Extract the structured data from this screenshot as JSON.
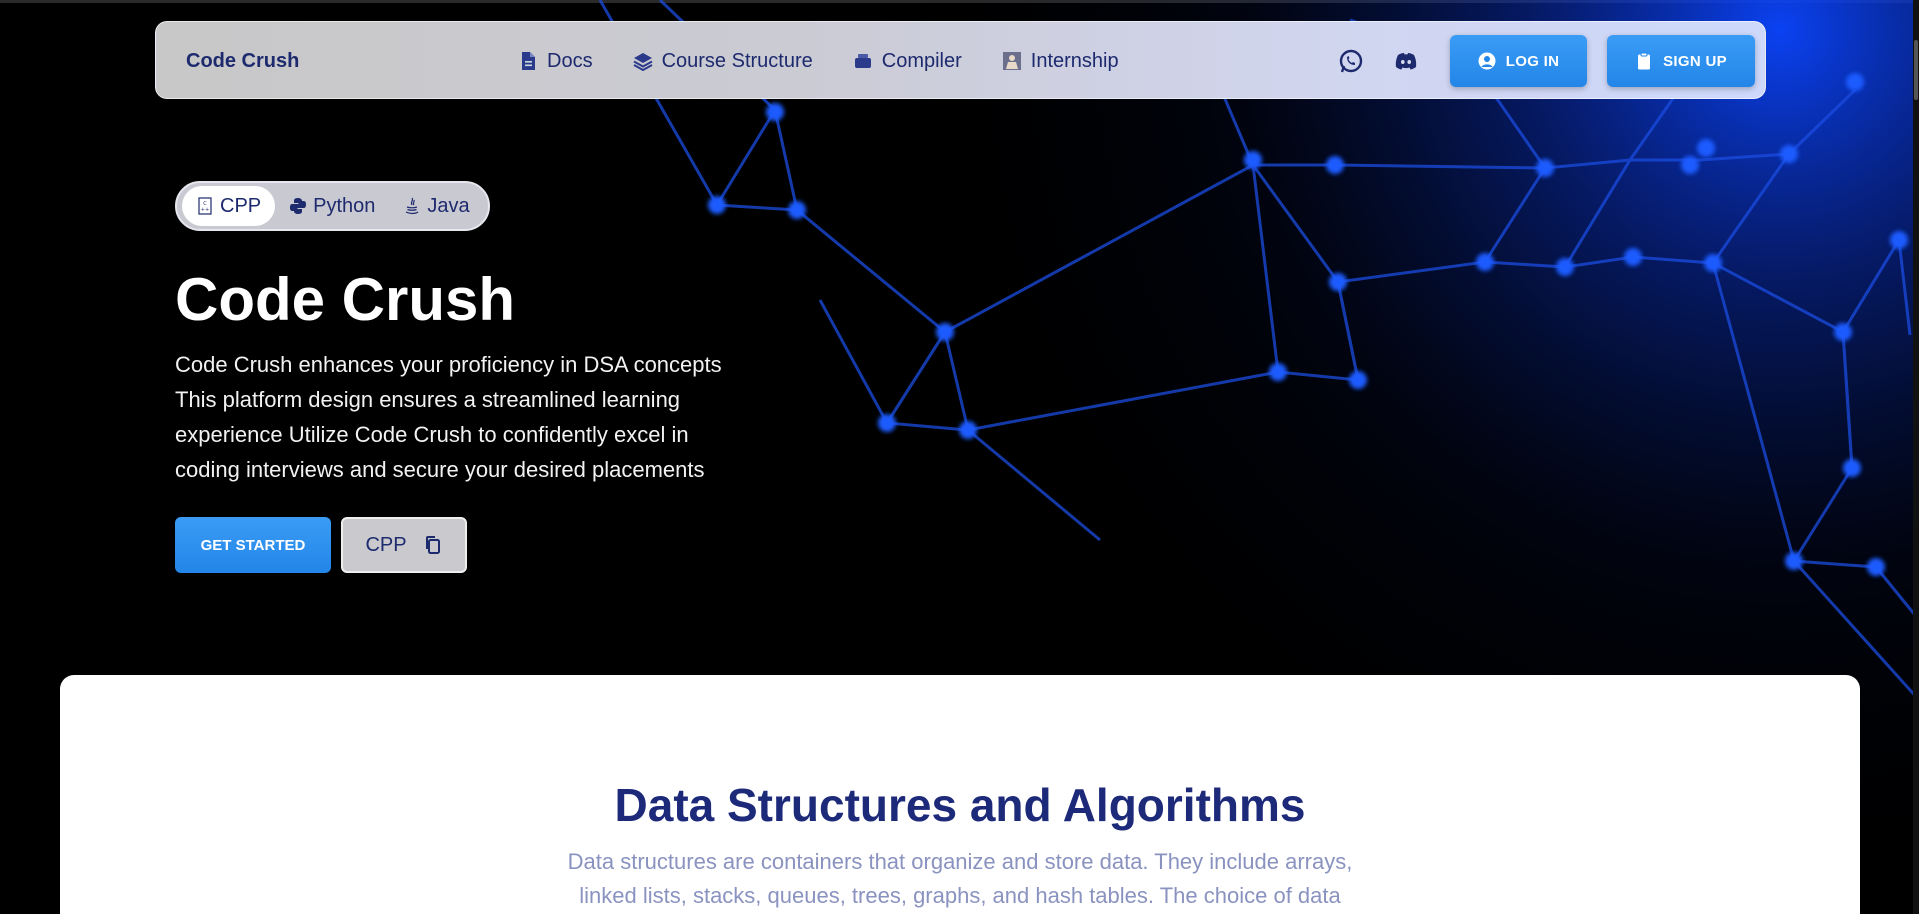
{
  "nav": {
    "brand": "Code Crush",
    "links": [
      {
        "label": "Docs",
        "icon": "document-icon"
      },
      {
        "label": "Course Structure",
        "icon": "layers-icon"
      },
      {
        "label": "Compiler",
        "icon": "compiler-icon"
      },
      {
        "label": "Internship",
        "icon": "internship-icon"
      }
    ],
    "social": [
      "whatsapp-icon",
      "discord-icon"
    ],
    "login_label": "LOG IN",
    "signup_label": "SIGN UP"
  },
  "hero": {
    "languages": [
      {
        "label": "CPP",
        "icon": "cpp-icon",
        "active": true
      },
      {
        "label": "Python",
        "icon": "python-icon",
        "active": false
      },
      {
        "label": "Java",
        "icon": "java-icon",
        "active": false
      }
    ],
    "title": "Code Crush",
    "description": "Code Crush enhances your proficiency in DSA concepts This platform design ensures a streamlined learning experience Utilize Code Crush to confidently excel in coding interviews and secure your desired placements",
    "get_started_label": "GET STARTED",
    "copy_label": "CPP"
  },
  "section": {
    "title": "Data Structures and Algorithms",
    "description": "Data structures are containers that organize and store data. They include arrays, linked lists, stacks, queues, trees, graphs, and hash tables. The choice of data"
  },
  "colors": {
    "accent": "#2386e8",
    "navy": "#1d2a6e",
    "network": "#1a5cff"
  }
}
